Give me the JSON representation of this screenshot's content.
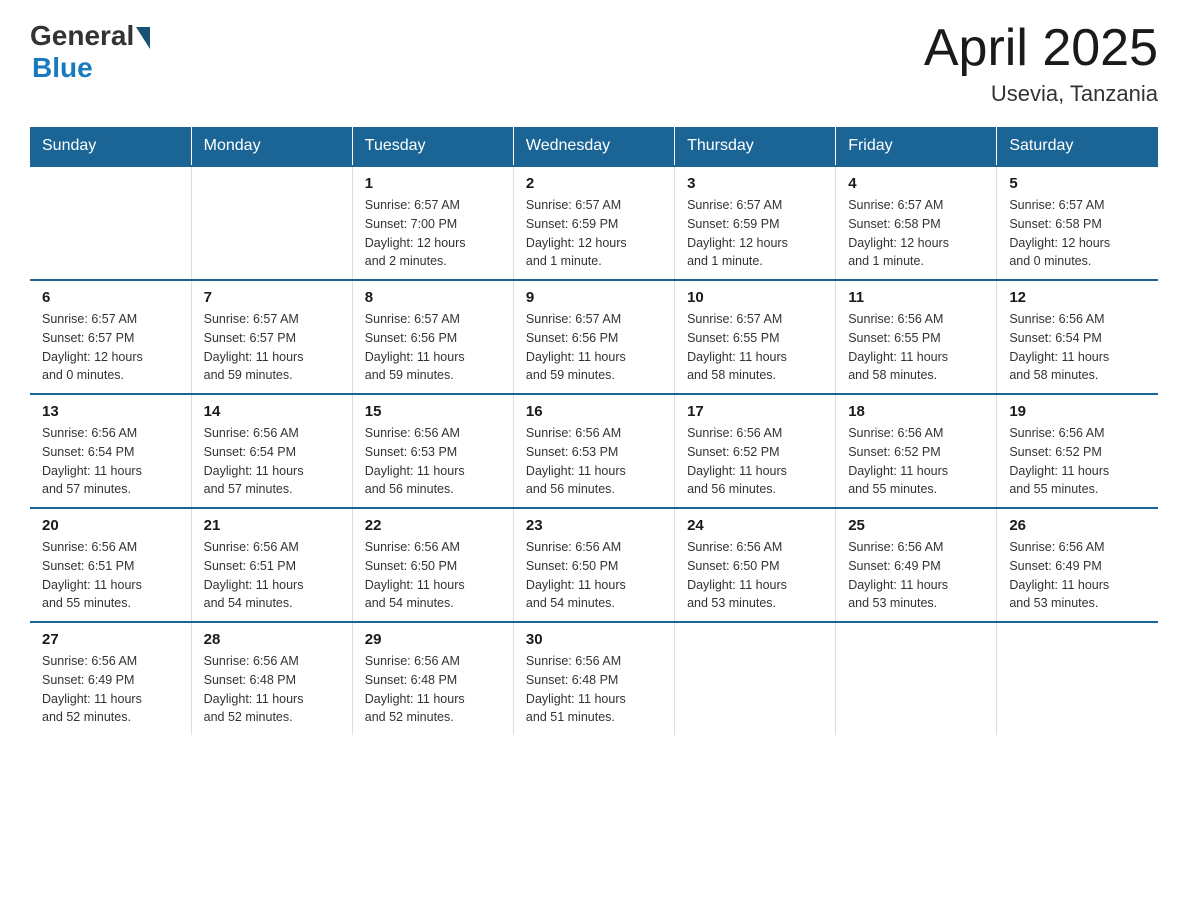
{
  "header": {
    "logo_general": "General",
    "logo_blue": "Blue",
    "title": "April 2025",
    "location": "Usevia, Tanzania"
  },
  "days_of_week": [
    "Sunday",
    "Monday",
    "Tuesday",
    "Wednesday",
    "Thursday",
    "Friday",
    "Saturday"
  ],
  "weeks": [
    [
      {
        "day": "",
        "info": ""
      },
      {
        "day": "",
        "info": ""
      },
      {
        "day": "1",
        "info": "Sunrise: 6:57 AM\nSunset: 7:00 PM\nDaylight: 12 hours\nand 2 minutes."
      },
      {
        "day": "2",
        "info": "Sunrise: 6:57 AM\nSunset: 6:59 PM\nDaylight: 12 hours\nand 1 minute."
      },
      {
        "day": "3",
        "info": "Sunrise: 6:57 AM\nSunset: 6:59 PM\nDaylight: 12 hours\nand 1 minute."
      },
      {
        "day": "4",
        "info": "Sunrise: 6:57 AM\nSunset: 6:58 PM\nDaylight: 12 hours\nand 1 minute."
      },
      {
        "day": "5",
        "info": "Sunrise: 6:57 AM\nSunset: 6:58 PM\nDaylight: 12 hours\nand 0 minutes."
      }
    ],
    [
      {
        "day": "6",
        "info": "Sunrise: 6:57 AM\nSunset: 6:57 PM\nDaylight: 12 hours\nand 0 minutes."
      },
      {
        "day": "7",
        "info": "Sunrise: 6:57 AM\nSunset: 6:57 PM\nDaylight: 11 hours\nand 59 minutes."
      },
      {
        "day": "8",
        "info": "Sunrise: 6:57 AM\nSunset: 6:56 PM\nDaylight: 11 hours\nand 59 minutes."
      },
      {
        "day": "9",
        "info": "Sunrise: 6:57 AM\nSunset: 6:56 PM\nDaylight: 11 hours\nand 59 minutes."
      },
      {
        "day": "10",
        "info": "Sunrise: 6:57 AM\nSunset: 6:55 PM\nDaylight: 11 hours\nand 58 minutes."
      },
      {
        "day": "11",
        "info": "Sunrise: 6:56 AM\nSunset: 6:55 PM\nDaylight: 11 hours\nand 58 minutes."
      },
      {
        "day": "12",
        "info": "Sunrise: 6:56 AM\nSunset: 6:54 PM\nDaylight: 11 hours\nand 58 minutes."
      }
    ],
    [
      {
        "day": "13",
        "info": "Sunrise: 6:56 AM\nSunset: 6:54 PM\nDaylight: 11 hours\nand 57 minutes."
      },
      {
        "day": "14",
        "info": "Sunrise: 6:56 AM\nSunset: 6:54 PM\nDaylight: 11 hours\nand 57 minutes."
      },
      {
        "day": "15",
        "info": "Sunrise: 6:56 AM\nSunset: 6:53 PM\nDaylight: 11 hours\nand 56 minutes."
      },
      {
        "day": "16",
        "info": "Sunrise: 6:56 AM\nSunset: 6:53 PM\nDaylight: 11 hours\nand 56 minutes."
      },
      {
        "day": "17",
        "info": "Sunrise: 6:56 AM\nSunset: 6:52 PM\nDaylight: 11 hours\nand 56 minutes."
      },
      {
        "day": "18",
        "info": "Sunrise: 6:56 AM\nSunset: 6:52 PM\nDaylight: 11 hours\nand 55 minutes."
      },
      {
        "day": "19",
        "info": "Sunrise: 6:56 AM\nSunset: 6:52 PM\nDaylight: 11 hours\nand 55 minutes."
      }
    ],
    [
      {
        "day": "20",
        "info": "Sunrise: 6:56 AM\nSunset: 6:51 PM\nDaylight: 11 hours\nand 55 minutes."
      },
      {
        "day": "21",
        "info": "Sunrise: 6:56 AM\nSunset: 6:51 PM\nDaylight: 11 hours\nand 54 minutes."
      },
      {
        "day": "22",
        "info": "Sunrise: 6:56 AM\nSunset: 6:50 PM\nDaylight: 11 hours\nand 54 minutes."
      },
      {
        "day": "23",
        "info": "Sunrise: 6:56 AM\nSunset: 6:50 PM\nDaylight: 11 hours\nand 54 minutes."
      },
      {
        "day": "24",
        "info": "Sunrise: 6:56 AM\nSunset: 6:50 PM\nDaylight: 11 hours\nand 53 minutes."
      },
      {
        "day": "25",
        "info": "Sunrise: 6:56 AM\nSunset: 6:49 PM\nDaylight: 11 hours\nand 53 minutes."
      },
      {
        "day": "26",
        "info": "Sunrise: 6:56 AM\nSunset: 6:49 PM\nDaylight: 11 hours\nand 53 minutes."
      }
    ],
    [
      {
        "day": "27",
        "info": "Sunrise: 6:56 AM\nSunset: 6:49 PM\nDaylight: 11 hours\nand 52 minutes."
      },
      {
        "day": "28",
        "info": "Sunrise: 6:56 AM\nSunset: 6:48 PM\nDaylight: 11 hours\nand 52 minutes."
      },
      {
        "day": "29",
        "info": "Sunrise: 6:56 AM\nSunset: 6:48 PM\nDaylight: 11 hours\nand 52 minutes."
      },
      {
        "day": "30",
        "info": "Sunrise: 6:56 AM\nSunset: 6:48 PM\nDaylight: 11 hours\nand 51 minutes."
      },
      {
        "day": "",
        "info": ""
      },
      {
        "day": "",
        "info": ""
      },
      {
        "day": "",
        "info": ""
      }
    ]
  ]
}
